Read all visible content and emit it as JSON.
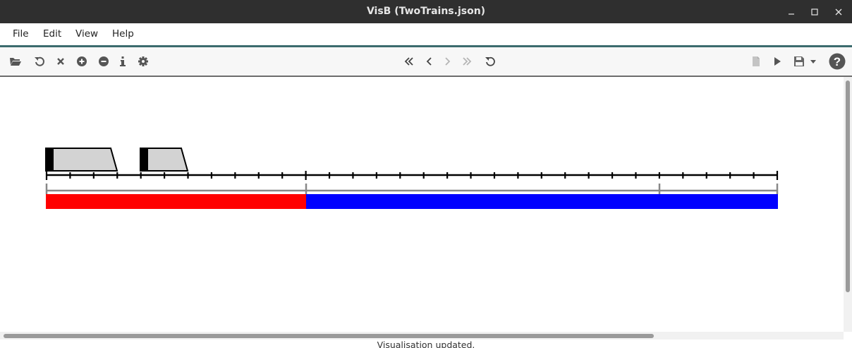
{
  "window": {
    "title": "VisB (TwoTrains.json)"
  },
  "menubar": {
    "items": [
      "File",
      "Edit",
      "View",
      "Help"
    ]
  },
  "toolbar": {
    "left_icons": [
      "open-folder-icon",
      "reload-icon",
      "close-icon",
      "zoom-in-icon",
      "zoom-out-icon",
      "info-icon",
      "settings-gear-icon"
    ],
    "nav_icons": [
      "fast-backward-icon",
      "back-icon",
      "forward-icon",
      "fast-forward-icon",
      "reset-icon"
    ],
    "right_icons": [
      "document-icon",
      "run-icon",
      "save-icon",
      "dropdown-icon",
      "help-icon"
    ]
  },
  "visualisation": {
    "trains": 2,
    "track_sections": [
      {
        "state": "occupied",
        "color": "#ff0000"
      },
      {
        "state": "free",
        "color": "#0000ff"
      }
    ]
  },
  "status": {
    "text": "Visualisation updated."
  }
}
